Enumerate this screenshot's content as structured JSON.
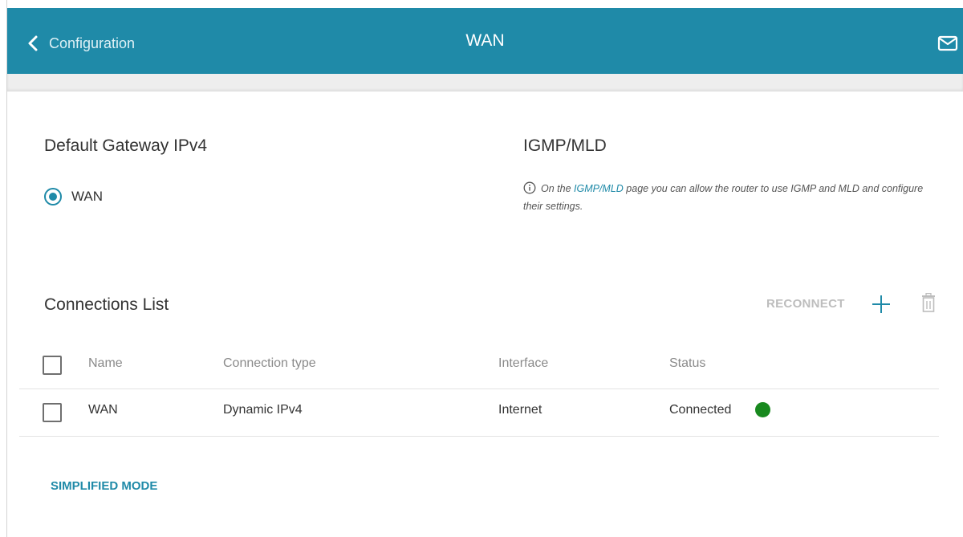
{
  "header": {
    "back_label": "Configuration",
    "title": "WAN",
    "icons": {
      "back": "chevron-left-icon",
      "mail": "mail-icon"
    },
    "bar_color": "#1f8aa8"
  },
  "default_gateway": {
    "title": "Default Gateway IPv4",
    "options": [
      {
        "label": "WAN",
        "selected": true
      }
    ]
  },
  "igmp": {
    "title": "IGMP/MLD",
    "info_prefix": "On the ",
    "info_link": "IGMP/MLD",
    "info_suffix": " page you can allow the router to use IGMP and MLD and configure their settings."
  },
  "connections": {
    "title": "Connections List",
    "reconnect_label": "RECONNECT",
    "columns": [
      "Name",
      "Connection type",
      "Interface",
      "Status"
    ],
    "rows": [
      {
        "name": "WAN",
        "type": "Dynamic IPv4",
        "interface": "Internet",
        "status": "Connected",
        "status_color": "#18891e"
      }
    ]
  },
  "footer": {
    "simplified_mode_label": "SIMPLIFIED MODE"
  },
  "colors": {
    "accent": "#1f8aa8",
    "disabled": "#bdbdbd",
    "status_ok": "#18891e"
  }
}
